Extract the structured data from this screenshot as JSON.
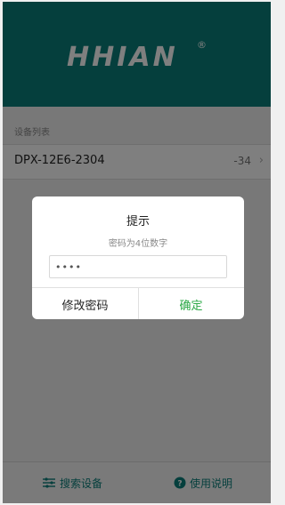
{
  "brand": {
    "logo_text": "HHIAN",
    "registered_mark": "®"
  },
  "device_list": {
    "label": "设备列表",
    "items": [
      {
        "name": "DPX-12E6-2304",
        "rssi": "-34"
      }
    ]
  },
  "dialog": {
    "title": "提示",
    "subtitle": "密码为4位数字",
    "password_value": "••••",
    "change_password_label": "修改密码",
    "confirm_label": "确定"
  },
  "bottom_bar": {
    "search_label": "搜索设备",
    "help_label": "使用说明"
  },
  "colors": {
    "header": "#0b7f7b",
    "confirm": "#2aa845",
    "tab": "#0b7f7b"
  },
  "icons": {
    "search_devices": "sliders-icon",
    "help": "question-circle-icon",
    "row": "chevron-right-icon"
  }
}
